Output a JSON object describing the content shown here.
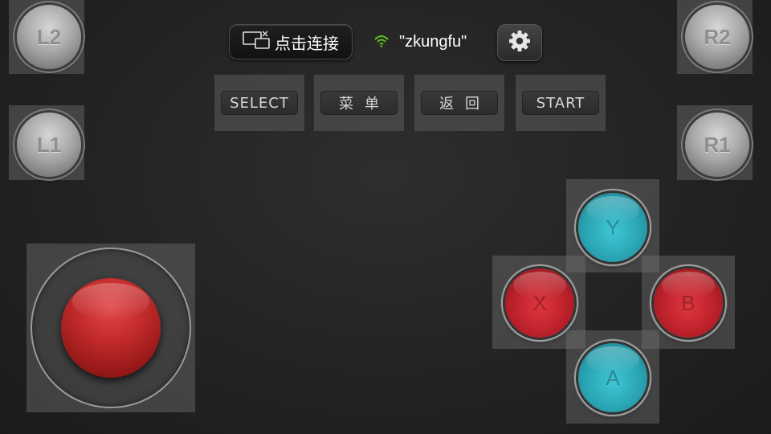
{
  "shoulders": {
    "l2": "L2",
    "l1": "L1",
    "r2": "R2",
    "r1": "R1"
  },
  "topbar": {
    "connect_label": "点击连接",
    "connect_icon": "cast-screen-icon",
    "wifi_icon": "wifi-icon",
    "wifi_color": "#5fbf1f",
    "ssid": "\"zkungfu\"",
    "settings_icon": "gear-icon"
  },
  "function_buttons": {
    "select": "SELECT",
    "menu": "菜单",
    "back": "返回",
    "start": "START"
  },
  "face_buttons": {
    "y": "Y",
    "x": "X",
    "b": "B",
    "a": "A",
    "teal_color": "#2aa3b2",
    "red_color": "#b92029"
  },
  "joystick": {
    "knob_color": "#c22a2a"
  }
}
